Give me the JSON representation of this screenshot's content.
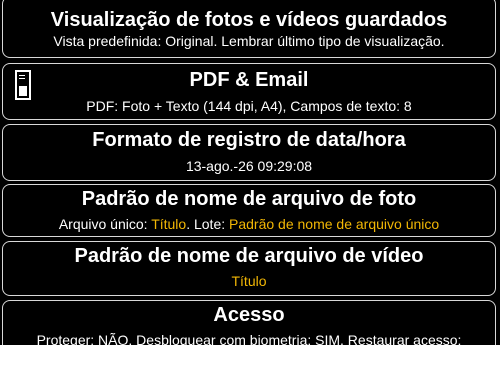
{
  "settings": [
    {
      "title": "Visualização de fotos e vídeos guardados",
      "subtitle_parts": [
        {
          "text": "Vista predefinida: Original. Lembrar último tipo de visualização.",
          "highlight": false
        }
      ]
    },
    {
      "icon": "pdf-document-icon",
      "title": "PDF & Email",
      "subtitle_parts": [
        {
          "text": "PDF: Foto + Texto (144 dpi, A4), Campos de texto: 8",
          "highlight": false
        }
      ]
    },
    {
      "title": "Formato de registro de data/hora",
      "subtitle_parts": [
        {
          "text": "13-ago.-26 09:29:08",
          "highlight": false
        }
      ]
    },
    {
      "title": "Padrão de nome de arquivo de foto",
      "subtitle_parts": [
        {
          "text": "Arquivo único: ",
          "highlight": false
        },
        {
          "text": "Título",
          "highlight": true
        },
        {
          "text": ". Lote: ",
          "highlight": false
        },
        {
          "text": "Padrão de nome de arquivo único",
          "highlight": true
        }
      ]
    },
    {
      "title": "Padrão de nome de arquivo de vídeo",
      "subtitle_parts": [
        {
          "text": "Título",
          "highlight": true
        }
      ]
    },
    {
      "title": "Acesso",
      "subtitle_parts": [
        {
          "text": "Proteger: NÃO. Desbloquear com biometria: SIM. Restaurar acesso:",
          "highlight": false
        }
      ]
    }
  ],
  "colors": {
    "background": "#000000",
    "text": "#ffffff",
    "highlight": "#f2b705",
    "border": "#d8d8d8"
  }
}
